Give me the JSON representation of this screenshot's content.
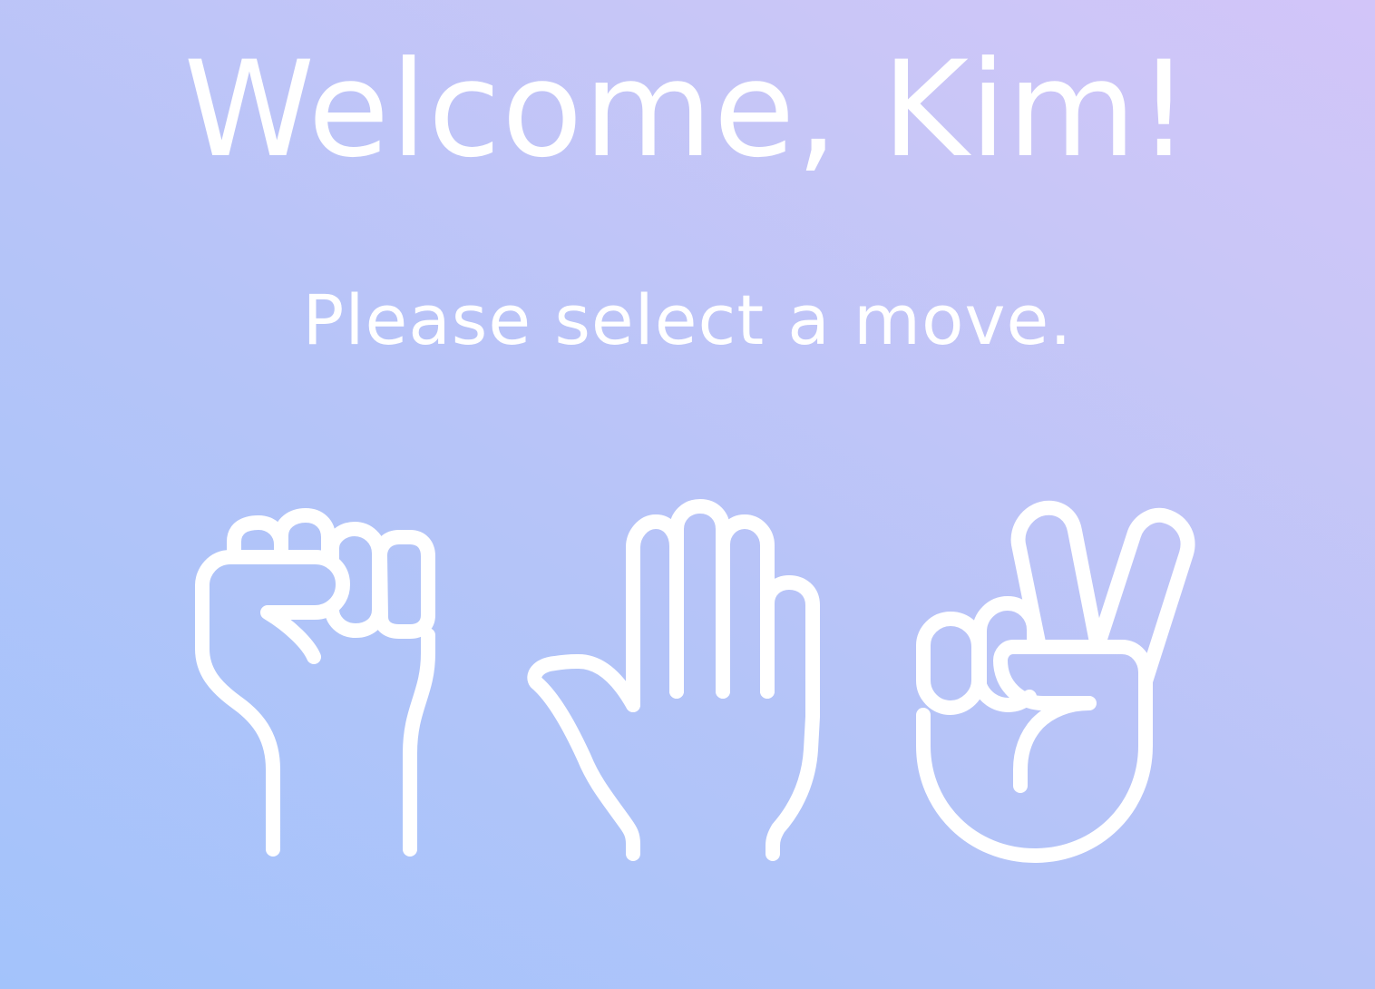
{
  "greeting": {
    "title": "Welcome, Kim!",
    "subtitle": "Please select a move."
  },
  "moves": [
    {
      "id": "rock",
      "icon": "fist-icon"
    },
    {
      "id": "paper",
      "icon": "open-hand-icon"
    },
    {
      "id": "scissors",
      "icon": "peace-hand-icon"
    }
  ],
  "colors": {
    "background_start": "#a3c3fb",
    "background_end": "#d2c5f9",
    "foreground": "#ffffff"
  }
}
